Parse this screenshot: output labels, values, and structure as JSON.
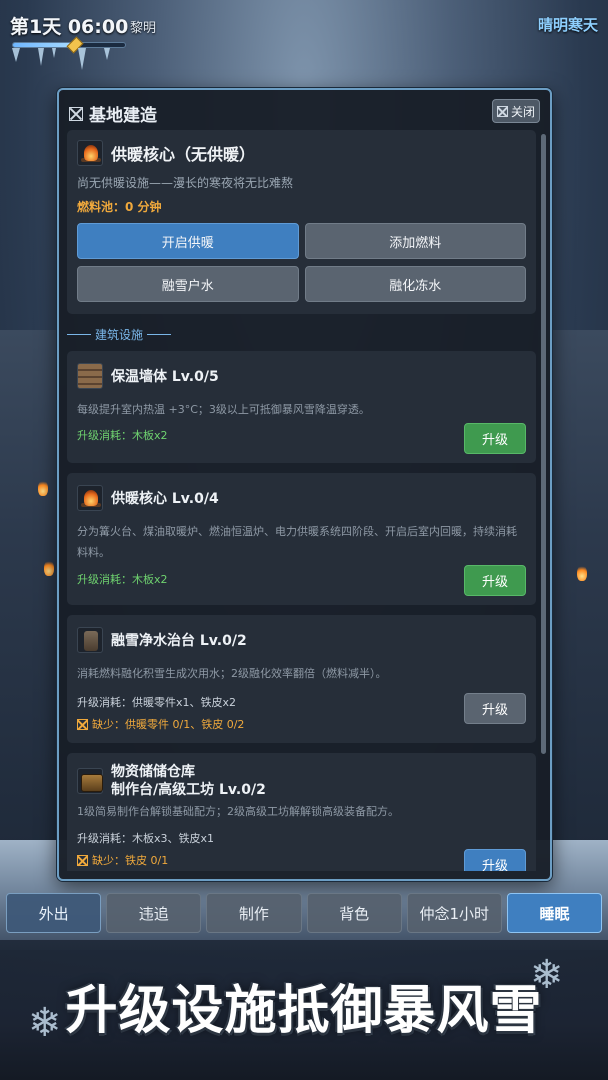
{
  "hud": {
    "day_time": "第1天 06:00",
    "phase": "黎明",
    "weather": "晴明寒天",
    "time_progress": 0.55
  },
  "panel": {
    "title": "基地建造",
    "close_label": "关闭",
    "core": {
      "title": "供暖核心（无供暖）",
      "desc": "尚无供暖设施——漫长的寒夜将无比难熬",
      "fuel": "燃料池：0 分钟",
      "buttons": {
        "start_heat": "开启供暖",
        "add_fuel": "添加燃料",
        "melt_water": "融雪户水",
        "thaw_water": "融化冻水"
      }
    },
    "section_label": "建筑设施",
    "buildings": [
      {
        "title": "保温墙体  Lv.0/5",
        "desc": "每级提升室内热温 +3°C；3级以上可抵御暴风雪降温穿透。",
        "cost": "升级消耗：木板x2",
        "button": "升级"
      },
      {
        "title": "供暖核心  Lv.0/4",
        "desc": "分为篝火台、煤油取暖炉、燃油恒温炉、电力供暖系统四阶段、开启后室内回暖，持续消耗料料。",
        "cost": "升级消耗：木板x2",
        "button": "升级"
      },
      {
        "title": "融雪净水治台  Lv.0/2",
        "desc": "消耗燃料融化积雪生成次用水；2级融化效率翻倍（燃料减半）。",
        "cost": "升级消耗：供暖零件x1、铁皮x2",
        "lack": "缺少：供暖零件 0/1、铁皮 0/2",
        "button": "升级"
      },
      {
        "title_line1": "物资储储仓库",
        "title_line2": "制作台/高级工坊  Lv.0/2",
        "desc": "1级简易制作台解锁基础配方；2级高级工坊解解锁高级装备配方。",
        "cost": "升级消耗：木板x3、铁皮x1",
        "lack": "缺少：铁皮 0/1",
        "button": "升级"
      }
    ]
  },
  "nav": {
    "out": "外出",
    "chase": "违追",
    "craft": "制作",
    "bag": "背色",
    "wait": "仲念1小时",
    "sleep": "睡眠"
  },
  "promo": "升级设施抵御暴风雪",
  "colors": {
    "accent_blue": "#3f7fc0",
    "accent_green": "#3f9a4f",
    "warning_orange": "#f0a93c",
    "panel_border": "#6c9ec4"
  }
}
